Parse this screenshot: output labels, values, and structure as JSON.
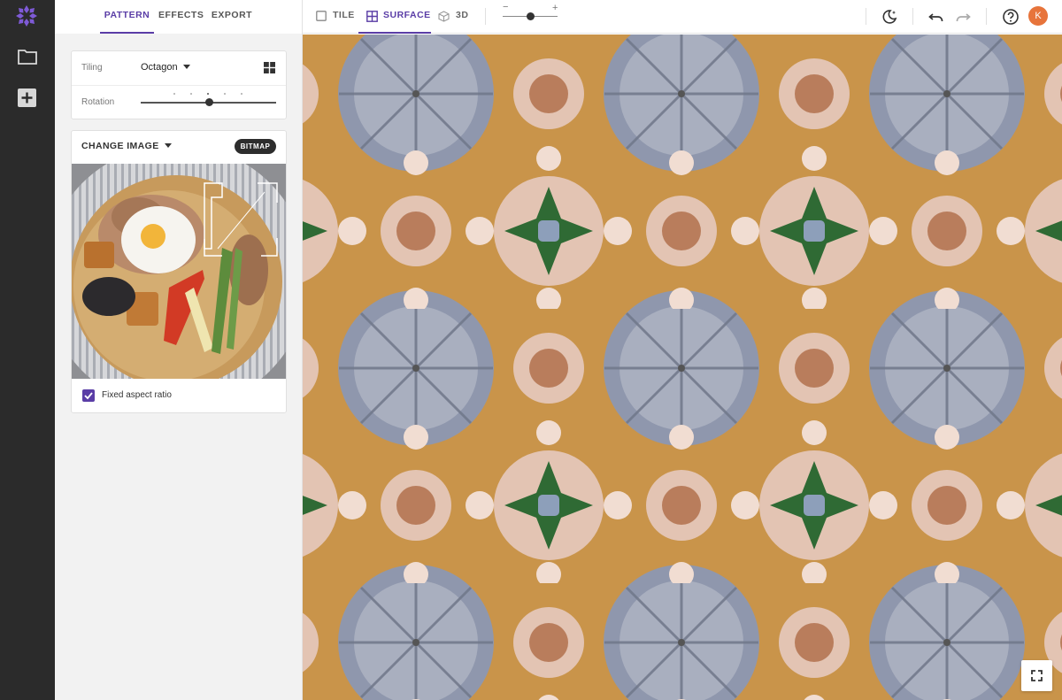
{
  "rail": {
    "items": [
      {
        "icon": "logo-icon"
      },
      {
        "icon": "folder-icon"
      },
      {
        "icon": "add-box-icon"
      }
    ]
  },
  "panel": {
    "tabs": [
      "PATTERN",
      "EFFECTS",
      "EXPORT"
    ],
    "active_tab": "PATTERN",
    "tiling": {
      "label": "Tiling",
      "value": "Octagon"
    },
    "rotation": {
      "label": "Rotation",
      "level": 0.5
    },
    "image": {
      "change_label": "CHANGE IMAGE",
      "badge": "BITMAP",
      "fixed_aspect_label": "Fixed aspect ratio",
      "fixed_aspect_checked": true
    }
  },
  "toolbar": {
    "tabs": [
      {
        "label": "TILE",
        "icon": "square-outline-icon"
      },
      {
        "label": "SURFACE",
        "icon": "grid-icon"
      },
      {
        "label": "3D",
        "icon": "cube-icon"
      }
    ],
    "active_tab": "SURFACE",
    "zoom": {
      "minus": "−",
      "plus": "+",
      "level": 0.5
    },
    "avatar_initial": "K",
    "icons": [
      "theme-icon",
      "undo-icon",
      "redo-icon",
      "help-icon"
    ]
  },
  "colors": {
    "accent": "#5a3da6",
    "rail_bg": "#2b2b2b",
    "avatar": "#e7743b"
  }
}
